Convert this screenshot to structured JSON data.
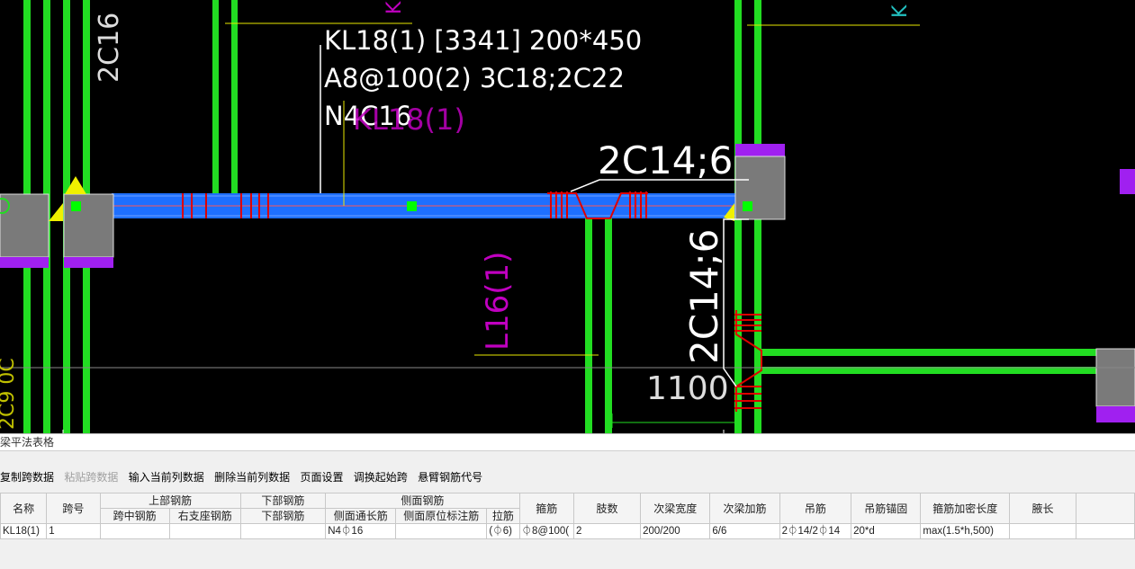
{
  "canvas": {
    "labels": {
      "beam_mark_line1": "KL18(1) [3341] 200*450",
      "beam_mark_line2": "A8@100(2) 3C18;2C22",
      "beam_mark_line3": "N4C16",
      "span_rebar_top": "2C14;6",
      "span_rebar_vertical": "2C14;6",
      "left_column_vertical": "2C16",
      "secondary_beam_ghost": "KL18(1)",
      "secondary_beam_l16": "L16(1)",
      "dimension": "1100",
      "corner_k_top": "K",
      "corner_k_right": "K",
      "left_edge_text": "2C9 0C"
    },
    "colors": {
      "column_green": "#22dd22",
      "beam_blue": "#1e6fff",
      "support_gray": "#7a7a7a",
      "purple": "#a020f0",
      "stirrup_red": "#dd0000",
      "magenta": "#c000c0",
      "leader_yellow": "#e8e800",
      "annotation_white": "#ffffff"
    }
  },
  "panel": {
    "title": "梁平法表格",
    "toolbar": [
      {
        "label": "复制跨数据",
        "enabled": true
      },
      {
        "label": "粘贴跨数据",
        "enabled": false
      },
      {
        "label": "输入当前列数据",
        "enabled": true
      },
      {
        "label": "删除当前列数据",
        "enabled": true
      },
      {
        "label": "页面设置",
        "enabled": true
      },
      {
        "label": "调换起始跨",
        "enabled": true
      },
      {
        "label": "悬臂钢筋代号",
        "enabled": true
      }
    ],
    "headers": {
      "name": "名称",
      "span_no": "跨号",
      "top_rebar": "上部钢筋",
      "top_mid": "跨中钢筋",
      "top_right": "右支座钢筋",
      "bottom_rebar": "下部钢筋",
      "bottom_sub": "下部钢筋",
      "side_rebar": "侧面钢筋",
      "side_through": "侧面通长筋",
      "side_original": "侧面原位标注筋",
      "tie": "拉筋",
      "stirrup": "箍筋",
      "legs": "肢数",
      "sec_width": "次梁宽度",
      "sec_add": "次梁加筋",
      "hanger": "吊筋",
      "hanger_anchor": "吊筋锚固",
      "dense_length": "箍筋加密长度",
      "haunch": "腋长"
    },
    "row": {
      "name": "KL18(1)",
      "span_no": "1",
      "top_mid": "",
      "top_right": "",
      "bottom": "",
      "side_through": "N4⏀16",
      "side_original": "",
      "tie": "(⏀6)",
      "stirrup": "⏀8@100(",
      "legs": "2",
      "sec_width": "200/200",
      "sec_add": "6/6",
      "hanger": "2⏀14/2⏀14",
      "hanger_anchor": "20*d",
      "dense_length": "max(1.5*h,500)",
      "haunch": ""
    }
  }
}
